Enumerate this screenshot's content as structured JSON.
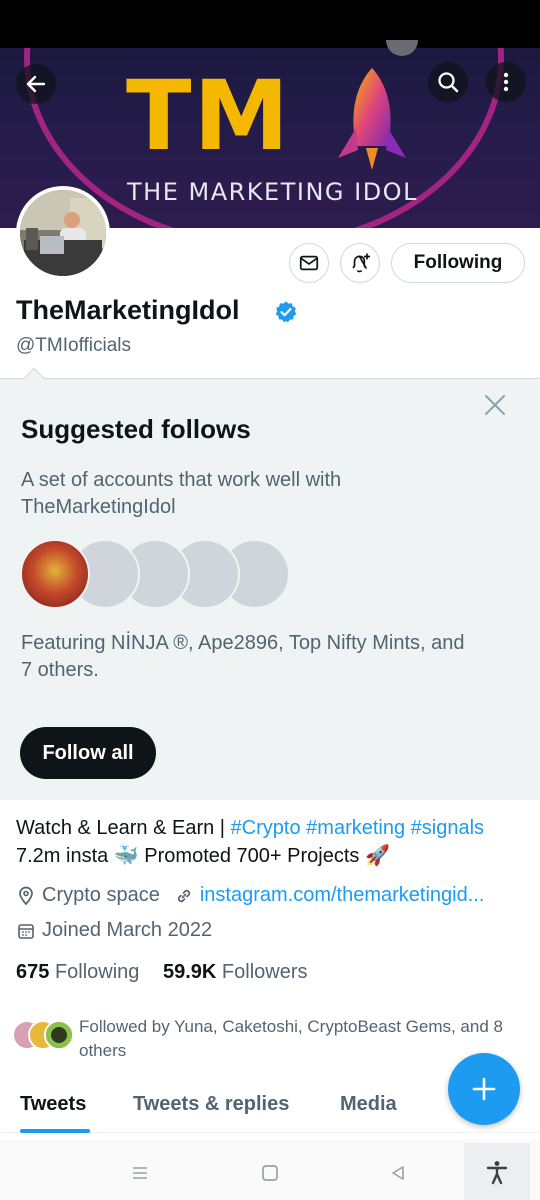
{
  "profile": {
    "banner_logo": "TM",
    "banner_tagline": "THE MARKETING IDOL",
    "display_name": "TheMarketingIdol",
    "handle": "@TMIofficials",
    "following_button": "Following"
  },
  "suggested": {
    "title": "Suggested follows",
    "description": "A set of accounts that work well with TheMarketingIdol",
    "featuring": "Featuring NİNJA ®, Ape2896, Top Nifty Mints, and 7 others.",
    "follow_all": "Follow all"
  },
  "bio": {
    "line1_text": "Watch & Learn & Earn | ",
    "tag1": "#Crypto",
    "tag2": "#marketing",
    "tag3": "#signals",
    "line2": "7.2m insta 🐳 Promoted 700+ Projects 🚀",
    "location": "Crypto space",
    "link": "instagram.com/themarketingid...",
    "joined": "Joined March 2022"
  },
  "stats": {
    "following_count": "675",
    "following_label": "Following",
    "followers_count": "59.9K",
    "followers_label": "Followers"
  },
  "followed_by": "Followed by Yuna, Caketoshi, CryptoBeast Gems, and 8 others",
  "tabs": [
    "Tweets",
    "Tweets & replies",
    "Media"
  ],
  "colors": {
    "accent": "#1d9bf0",
    "text_primary": "#0f1419",
    "text_secondary": "#536471",
    "suggest_bg": "#eff3f4",
    "banner_gold": "#f5b800"
  },
  "icons": [
    "back-arrow-icon",
    "search-icon",
    "more-icon",
    "envelope-icon",
    "bell-plus-icon",
    "close-icon",
    "verified-badge-icon",
    "location-icon",
    "link-icon",
    "calendar-icon",
    "compose-plus-icon",
    "menu-icon",
    "home-square-icon",
    "back-triangle-icon",
    "accessibility-icon"
  ]
}
